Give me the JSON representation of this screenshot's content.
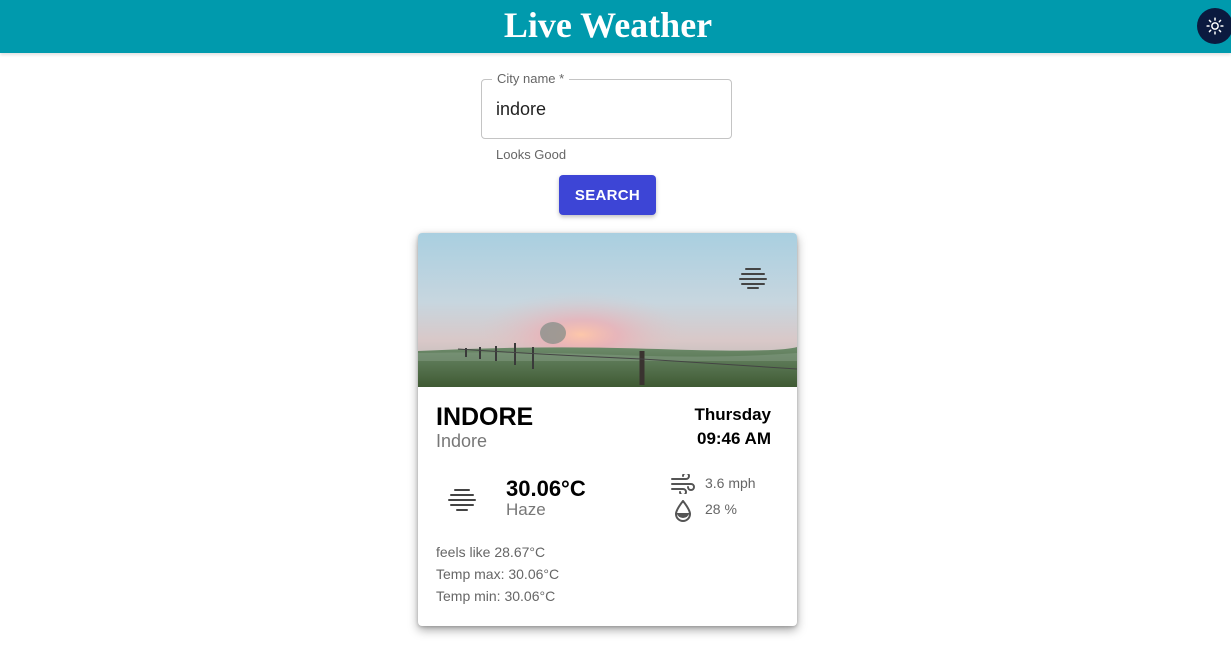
{
  "header": {
    "title": "Live Weather",
    "theme_icon": "sun-icon",
    "background": "#009aad"
  },
  "search": {
    "label": "City name *",
    "value": "indore",
    "helper": "Looks Good",
    "button_label": "SEARCH",
    "button_color": "#3d45d6"
  },
  "weather_card": {
    "image_icon": "haze-icon",
    "city": "INDORE",
    "city_subtitle": "Indore",
    "day": "Thursday",
    "time": "09:46 AM",
    "condition_icon": "haze-icon",
    "temperature": "30.06°C",
    "condition": "Haze",
    "wind_icon": "wind-icon",
    "wind": "3.6 mph",
    "humidity_icon": "water-drop-icon",
    "humidity": "28 %",
    "feels_like": "feels like 28.67°C",
    "temp_max": "Temp max: 30.06°C",
    "temp_min": "Temp min: 30.06°C"
  }
}
